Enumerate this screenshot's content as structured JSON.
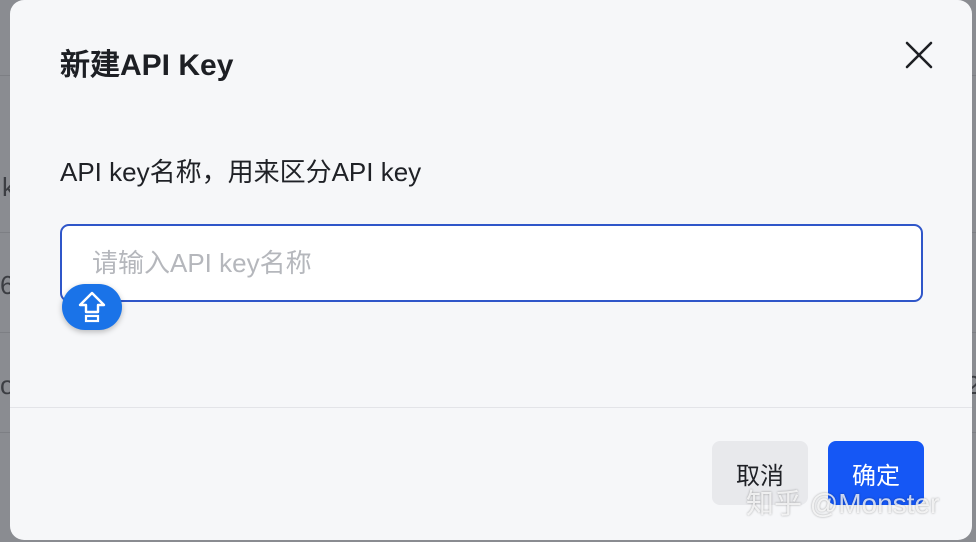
{
  "background": {
    "fragments": [
      "k",
      "6",
      "o",
      "2"
    ]
  },
  "dialog": {
    "title": "新建API Key",
    "close_icon": "close-icon",
    "field_label": "API key名称，用来区分API key",
    "input": {
      "value": "",
      "placeholder": "请输入API key名称"
    },
    "keyboard_toggle_icon": "keyboard-shift-icon",
    "cancel_label": "取消",
    "confirm_label": "确定"
  },
  "watermark": "知乎 @Monster",
  "colors": {
    "primary": "#1557f5",
    "input_border": "#2f56c9",
    "keyboard_button": "#1a73e8"
  }
}
